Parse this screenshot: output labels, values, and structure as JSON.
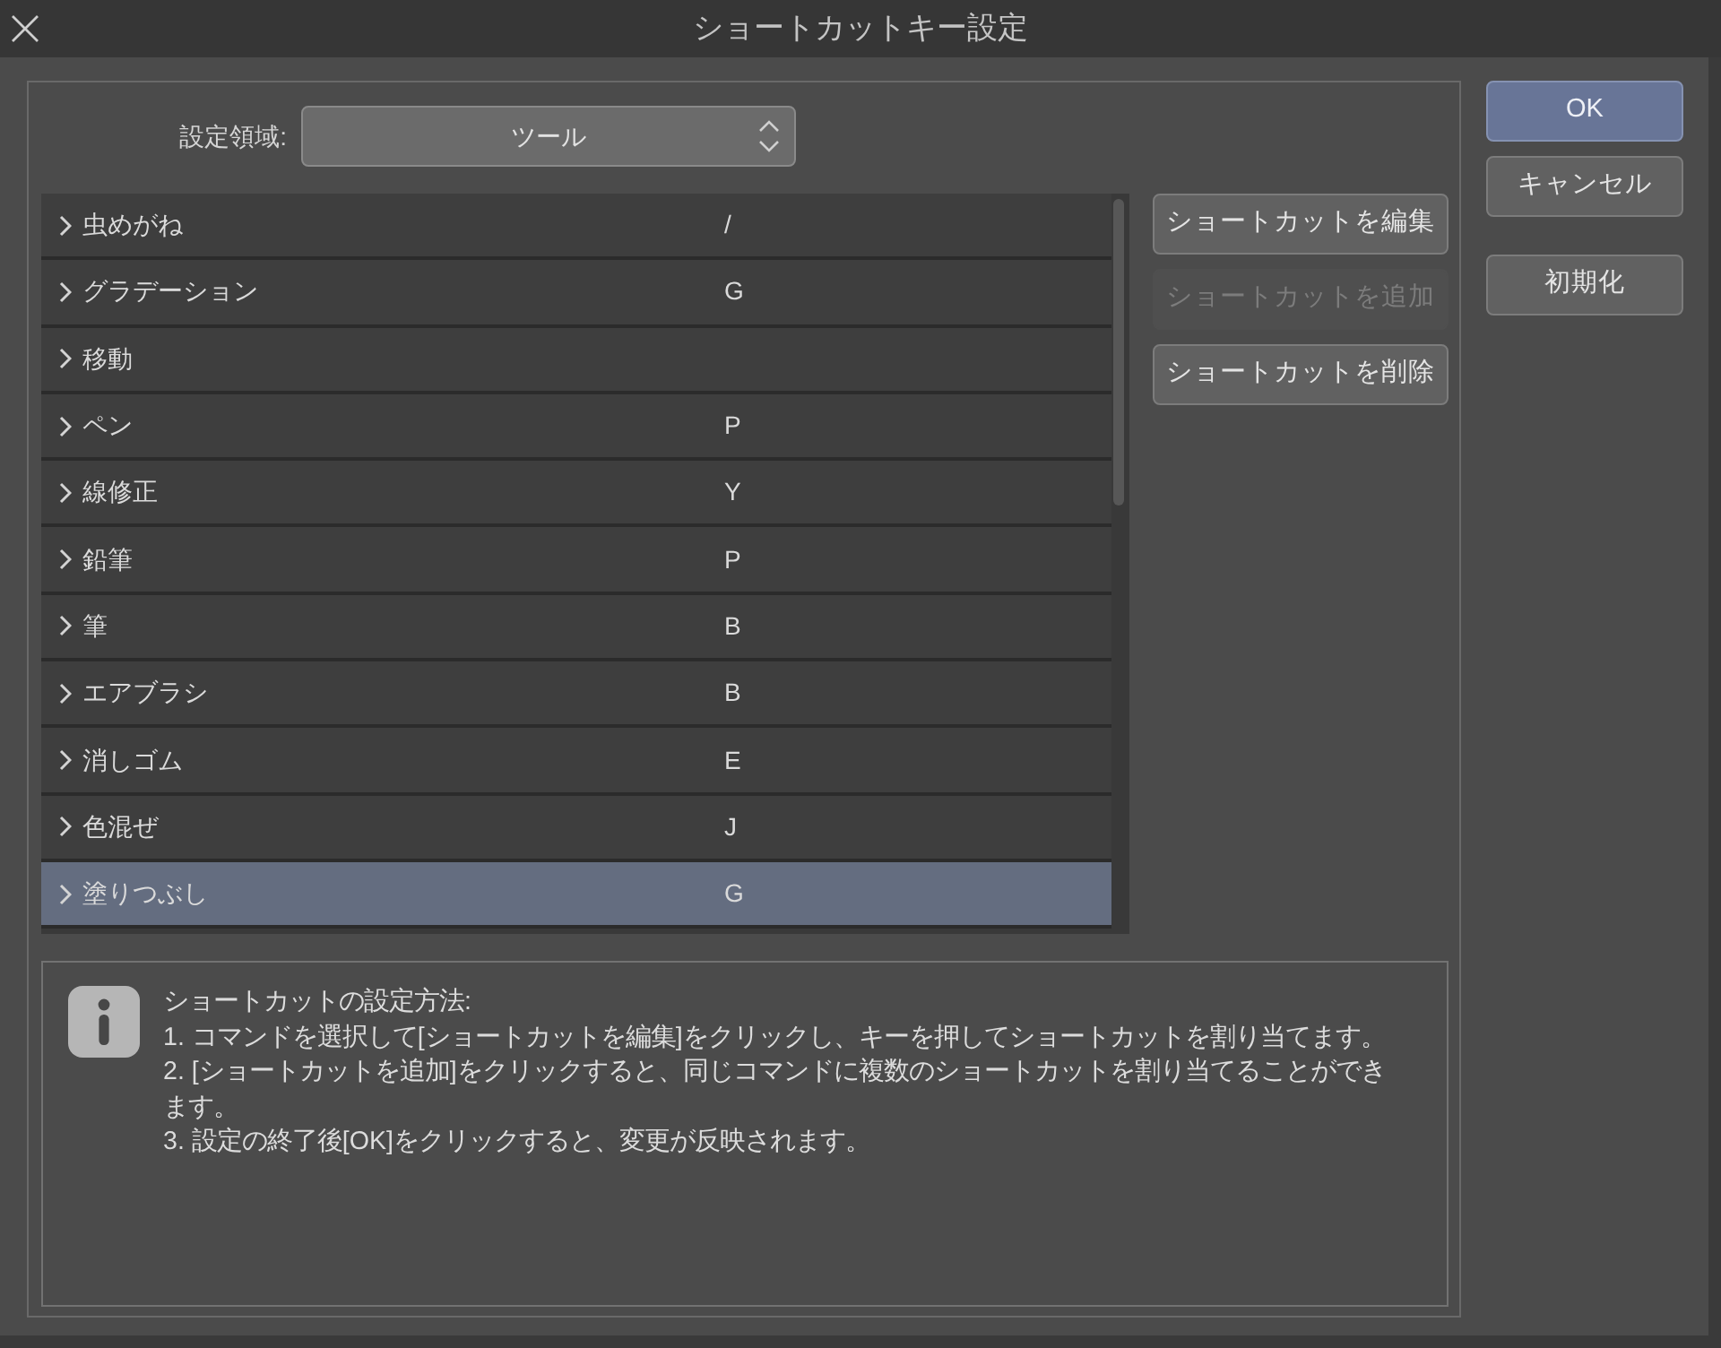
{
  "window": {
    "title": "ショートカットキー設定"
  },
  "settings_area": {
    "label": "設定領域:",
    "value": "ツール"
  },
  "commands": [
    {
      "name": "虫めがね",
      "shortcut": "/",
      "expanded": false,
      "selected": false
    },
    {
      "name": "グラデーション",
      "shortcut": "G",
      "expanded": false,
      "selected": false
    },
    {
      "name": "移動",
      "expanded": false,
      "selected": false
    },
    {
      "name": "ペン",
      "shortcut": "P",
      "expanded": false,
      "selected": false
    },
    {
      "name": "線修正",
      "shortcut": "Y",
      "expanded": false,
      "selected": false
    },
    {
      "name": "鉛筆",
      "shortcut": "P",
      "expanded": false,
      "selected": false
    },
    {
      "name": "筆",
      "shortcut": "B",
      "expanded": false,
      "selected": false
    },
    {
      "name": "エアブラシ",
      "shortcut": "B",
      "expanded": false,
      "selected": false
    },
    {
      "name": "消しゴム",
      "shortcut": "E",
      "expanded": false,
      "selected": false
    },
    {
      "name": "色混ぜ",
      "shortcut": "J",
      "expanded": false,
      "selected": false
    },
    {
      "name": "塗りつぶし",
      "shortcut": "G",
      "expanded": false,
      "selected": true
    }
  ],
  "command_buttons": [
    {
      "label": "ショートカットを編集",
      "disabled": false
    },
    {
      "label": "ショートカットを追加",
      "disabled": true
    },
    {
      "label": "ショートカットを削除",
      "disabled": false
    }
  ],
  "dialog_buttons": [
    {
      "label": "OK",
      "default": true
    },
    {
      "label": "キャンセル",
      "default": false
    }
  ],
  "reset_button": {
    "label": "初期化"
  },
  "info": {
    "heading": "ショートカットの設定方法:",
    "steps": [
      "1. コマンドを選択して[ショートカットを編集]をクリックし、キーを押してショートカットを割り当てます。",
      "2. [ショートカットを追加]をクリックすると、同じコマンドに複数のショートカットを割り当てることができます。",
      "3. 設定の終了後[OK]をクリックすると、変更が反映されます。"
    ]
  }
}
